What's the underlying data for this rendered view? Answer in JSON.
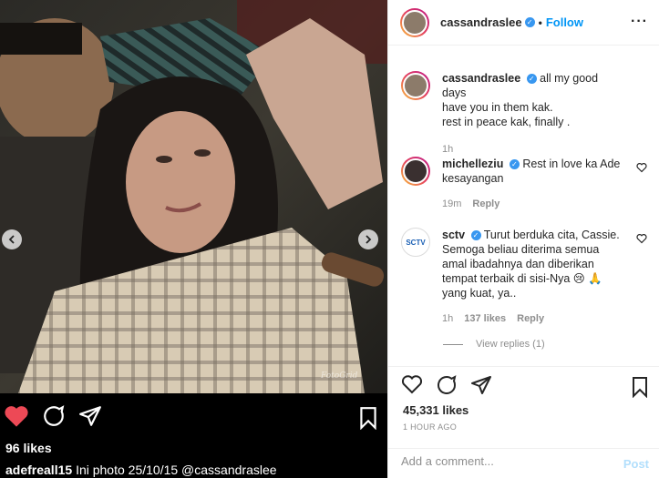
{
  "header": {
    "username": "cassandraslee",
    "separator": "•",
    "follow_label": "Follow",
    "more_label": "···"
  },
  "caption": {
    "username": "cassandraslee",
    "text_line1": "all my good days",
    "text_line2": "have you in them kak.",
    "text_line3": "rest in peace kak, finally .",
    "time": "1h"
  },
  "comments": [
    {
      "username": "michelleziu",
      "text_line1": "Rest in love ka Ade",
      "text_line2": "kesayangan",
      "time": "19m",
      "reply_label": "Reply"
    },
    {
      "username": "sctv",
      "text_line1": "Turut berduka cita, Cassie.",
      "text_line2": "Semoga beliau diterima semua",
      "text_line3": "amal ibadahnya dan diberikan",
      "text_line4": "tempat terbaik di sisi-Nya 😢 🙏",
      "text_line5": "yang kuat, ya..",
      "time": "1h",
      "likes": "137 likes",
      "reply_label": "Reply",
      "view_replies": "View replies (1)"
    }
  ],
  "post": {
    "likes": "45,331 likes",
    "timestamp": "1 HOUR AGO"
  },
  "comment_box": {
    "placeholder": "Add a comment...",
    "post_label": "Post"
  },
  "inner_post": {
    "likes": "96 likes",
    "caption_user": "adefreall15",
    "caption_text": "Ini photo 25/10/15 @cassandraslee",
    "watermark": "FotoGrid"
  },
  "colors": {
    "accent": "#0095f6",
    "verified": "#3897f0",
    "like_red": "#ed4956",
    "muted": "#8e8e8e"
  }
}
